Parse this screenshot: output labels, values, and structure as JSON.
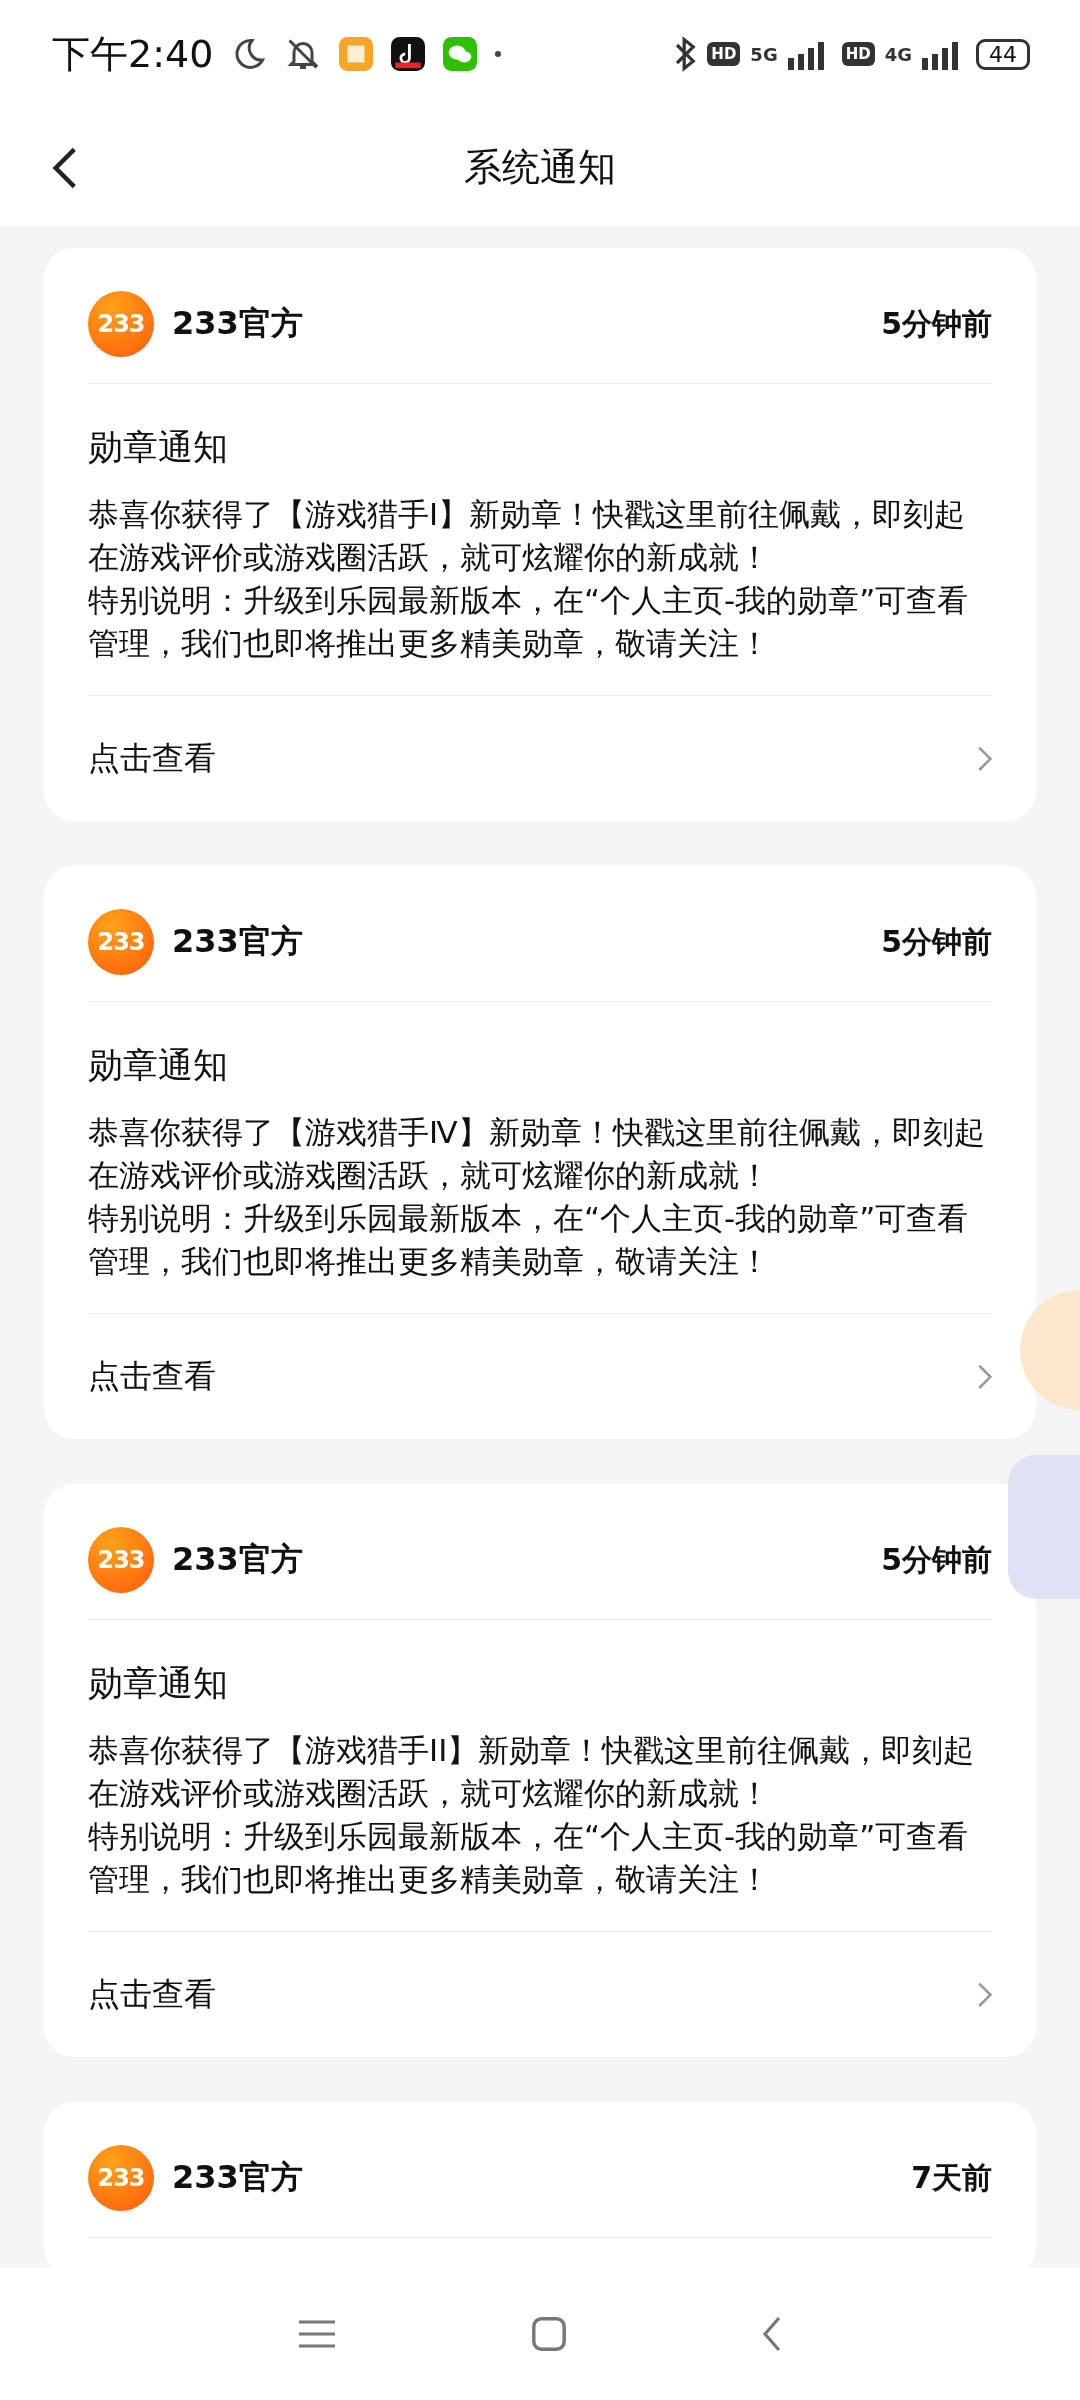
{
  "status_bar": {
    "time": "下午2:40",
    "sim1_badge": "HD",
    "sim1_network": "5G",
    "sim2_badge": "HD",
    "sim2_network": "4G",
    "battery": "44"
  },
  "header": {
    "title": "系统通知"
  },
  "notifications": [
    {
      "sender": "233官方",
      "avatar_text": "233",
      "time": "5分钟前",
      "title": "勋章通知",
      "body": [
        "恭喜你获得了【游戏猎手I】新勋章！快戳这里前往佩戴，即刻起在游戏评价或游戏圈活跃，就可炫耀你的新成就！",
        "特别说明：升级到乐园最新版本，在“个人主页-我的勋章”可查看管理，我们也即将推出更多精美勋章，敬请关注！"
      ],
      "action": "点击查看"
    },
    {
      "sender": "233官方",
      "avatar_text": "233",
      "time": "5分钟前",
      "title": "勋章通知",
      "body": [
        "恭喜你获得了【游戏猎手Ⅳ】新勋章！快戳这里前往佩戴，即刻起在游戏评价或游戏圈活跃，就可炫耀你的新成就！",
        "特别说明：升级到乐园最新版本，在“个人主页-我的勋章”可查看管理，我们也即将推出更多精美勋章，敬请关注！"
      ],
      "action": "点击查看"
    },
    {
      "sender": "233官方",
      "avatar_text": "233",
      "time": "5分钟前",
      "title": "勋章通知",
      "body": [
        "恭喜你获得了【游戏猎手II】新勋章！快戳这里前往佩戴，即刻起在游戏评价或游戏圈活跃，就可炫耀你的新成就！",
        "特别说明：升级到乐园最新版本，在“个人主页-我的勋章”可查看管理，我们也即将推出更多精美勋章，敬请关注！"
      ],
      "action": "点击查看"
    },
    {
      "sender": "233官方",
      "avatar_text": "233",
      "time": "7天前"
    }
  ]
}
